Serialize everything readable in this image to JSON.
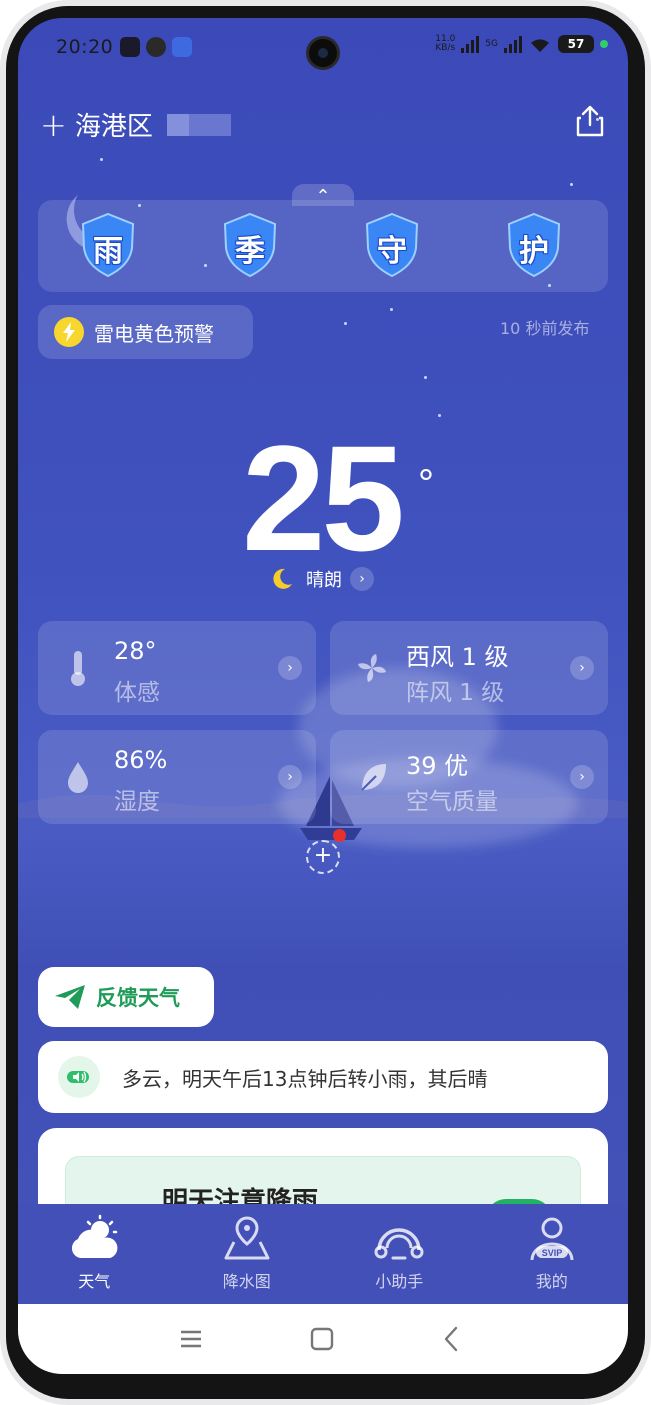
{
  "status": {
    "time": "20:20",
    "net_speed_value": "11.0",
    "net_speed_unit": "KB/s",
    "network": "5G",
    "battery": "57"
  },
  "header": {
    "location": "海港区"
  },
  "banner": {
    "chars": [
      "雨",
      "季",
      "守",
      "护"
    ]
  },
  "alert": {
    "label": "雷电黄色预警",
    "published": "10 秒前发布"
  },
  "current": {
    "temperature": "25",
    "degree_symbol": "°",
    "condition": "晴朗"
  },
  "metrics": {
    "feels_like": {
      "value": "28°",
      "label": "体感"
    },
    "wind": {
      "value": "西风 1 级",
      "label": "阵风 1 级"
    },
    "humidity": {
      "value": "86%",
      "label": "湿度"
    },
    "air": {
      "value": "39 优",
      "label": "空气质量"
    }
  },
  "feedback": {
    "label": "反馈天气"
  },
  "forecast": {
    "text": "多云，明天午后13点钟后转小雨，其后晴"
  },
  "notice_card": {
    "title": "明天注意降雨"
  },
  "tabs": [
    {
      "label": "天气",
      "icon": "weather-icon"
    },
    {
      "label": "降水图",
      "icon": "map-pin-icon"
    },
    {
      "label": "小助手",
      "icon": "assistant-icon"
    },
    {
      "label": "我的",
      "icon": "profile-svip-icon"
    }
  ],
  "colors": {
    "background": "#3f4fb6",
    "alert_yellow": "#f7d72e",
    "accent_green": "#1f9b58",
    "shield_blue": "#2f73f0"
  }
}
